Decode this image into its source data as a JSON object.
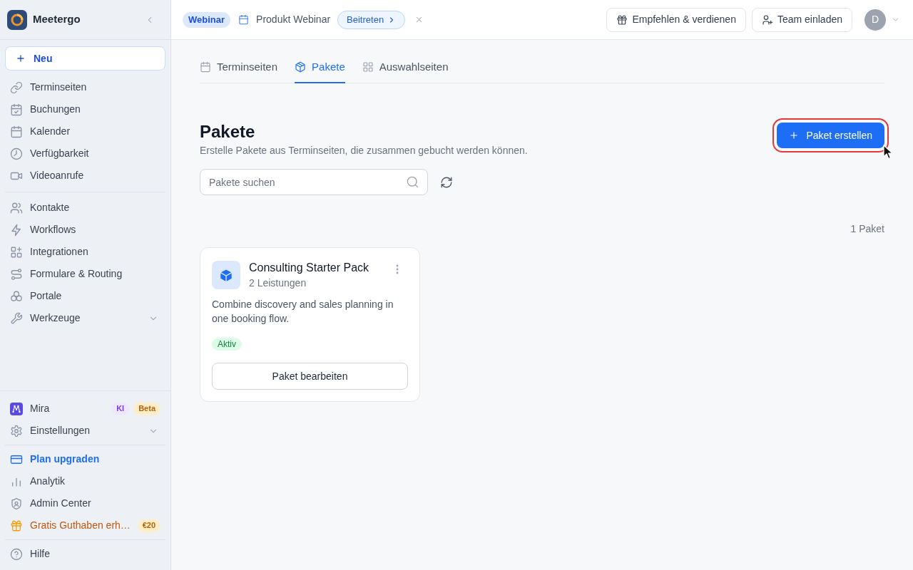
{
  "sidebar": {
    "brand": "Meetergo",
    "new_button": "Neu",
    "nav_sections": [
      {
        "items": [
          {
            "label": "Terminseiten",
            "kind": "link"
          },
          {
            "label": "Buchungen",
            "kind": "link"
          },
          {
            "label": "Kalender",
            "kind": "link"
          },
          {
            "label": "Verfügbarkeit",
            "kind": "link"
          },
          {
            "label": "Videoanrufe",
            "kind": "link"
          }
        ]
      },
      {
        "items": [
          {
            "label": "Kontakte",
            "kind": "link"
          },
          {
            "label": "Workflows",
            "kind": "link"
          },
          {
            "label": "Integrationen",
            "kind": "link"
          },
          {
            "label": "Formulare & Routing",
            "kind": "link"
          },
          {
            "label": "Portale",
            "kind": "link"
          },
          {
            "label": "Werkzeuge",
            "kind": "group"
          }
        ]
      }
    ],
    "footer_sections": [
      {
        "items": [
          {
            "label": "Mira",
            "kind": "assistant",
            "badges": [
              {
                "text": "KI",
                "kind": "ai"
              },
              {
                "text": "Beta",
                "kind": "beta"
              }
            ]
          },
          {
            "label": "Einstellungen",
            "kind": "group"
          }
        ]
      },
      {
        "items": [
          {
            "label": "Plan upgraden",
            "kind": "upgrade"
          },
          {
            "label": "Analytik",
            "kind": "link"
          },
          {
            "label": "Admin Center",
            "kind": "link"
          },
          {
            "label": "Gratis Guthaben erh…",
            "kind": "promo",
            "badges": [
              {
                "text": "€20",
                "kind": "reward"
              }
            ]
          }
        ]
      },
      {
        "items": [
          {
            "label": "Hilfe",
            "kind": "link"
          }
        ]
      }
    ]
  },
  "top_bar": {
    "announcement": {
      "badge": "Webinar",
      "title": "Produkt Webinar",
      "action": "Beitreten"
    },
    "actions": [
      {
        "label": "Empfehlen & verdienen"
      },
      {
        "label": "Team einladen"
      }
    ],
    "avatar": {
      "initial": "D"
    }
  },
  "tabs": [
    {
      "label": "Terminseiten",
      "selected": false
    },
    {
      "label": "Pakete",
      "selected": true
    },
    {
      "label": "Auswahlseiten",
      "selected": false
    }
  ],
  "page": {
    "title": "Pakete",
    "subtitle": "Erstelle Pakete aus Terminseiten, die zusammen gebucht werden können.",
    "create_button": {
      "label": "Paket erstellen",
      "highlighted": true,
      "hovered": true
    },
    "search": {
      "placeholder": "Pakete suchen"
    },
    "count": "1 Paket",
    "packages": [
      {
        "name": "Consulting Starter Pack",
        "services": "2 Leistungen",
        "description": "Combine discovery and sales planning in one booking flow.",
        "status": "Aktiv",
        "action": "Paket bearbeiten"
      }
    ]
  }
}
